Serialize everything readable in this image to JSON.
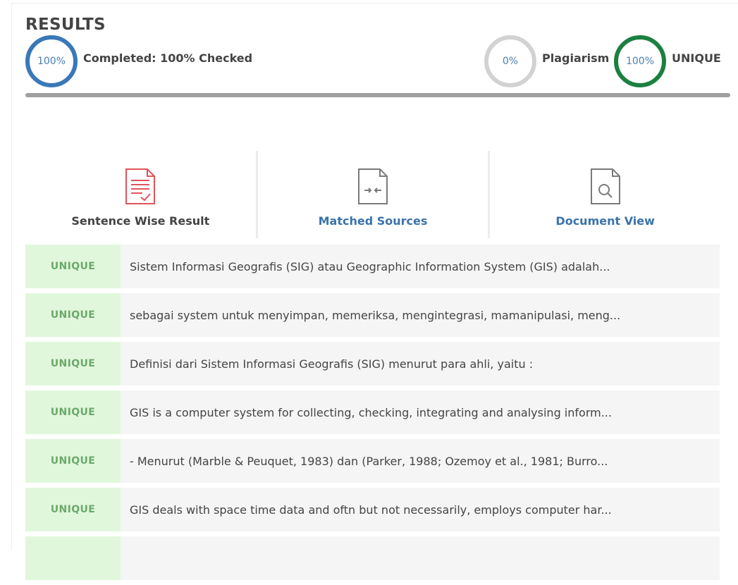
{
  "results": {
    "title": "RESULTS",
    "completed_percent": "100%",
    "completed_label": "Completed: 100% Checked",
    "plagiarism_percent": "0%",
    "plagiarism_label": "Plagiarism",
    "unique_percent": "100%",
    "unique_label": "UNIQUE",
    "progress": 1.0
  },
  "tabs": [
    {
      "label": "Sentence Wise Result",
      "icon": "document-check-icon"
    },
    {
      "label": "Matched Sources",
      "icon": "file-compare-icon"
    },
    {
      "label": "Document View",
      "icon": "file-search-icon"
    }
  ],
  "rows": [
    {
      "status": "UNIQUE",
      "text": "Sistem Informasi Geografis (SIG) atau Geographic Information System (GIS) adalah..."
    },
    {
      "status": "UNIQUE",
      "text": "sebagai system untuk menyimpan, memeriksa, mengintegrasi, mamanipulasi, meng..."
    },
    {
      "status": "UNIQUE",
      "text": "Definisi dari Sistem Informasi Geografis (SIG) menurut para ahli, yaitu :"
    },
    {
      "status": "UNIQUE",
      "text": "GIS is a computer system for collecting, checking, integrating and analysing inform..."
    },
    {
      "status": "UNIQUE",
      "text": "- Menurut (Marble & Peuquet, 1983) dan (Parker, 1988; Ozemoy et al., 1981; Burro..."
    },
    {
      "status": "UNIQUE",
      "text": "GIS deals with space time data and oftn but not necessarily, employs computer har..."
    },
    {
      "status": "UNIQUE",
      "text": ""
    }
  ],
  "colors": {
    "completed_ring": "#3a78b8",
    "plagiarism_ring": "#d2d2d2",
    "unique_ring": "#1b8040",
    "badge_bg": "#e1f7dc",
    "badge_text": "#6aa96a",
    "link": "#3a73aa",
    "icon_red": "#e0545a"
  }
}
